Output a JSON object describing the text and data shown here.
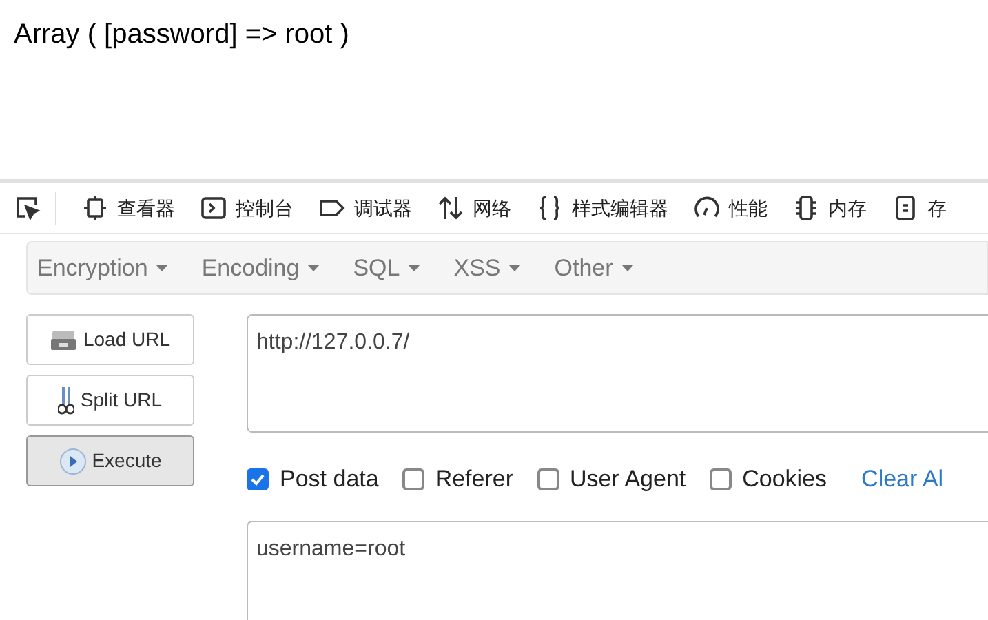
{
  "output_text": "Array ( [password] => root )",
  "devtools_tabs": [
    {
      "kind": "picker"
    },
    {
      "kind": "inspector",
      "label": "查看器"
    },
    {
      "kind": "console",
      "label": "控制台"
    },
    {
      "kind": "debugger",
      "label": "调试器"
    },
    {
      "kind": "network",
      "label": "网络"
    },
    {
      "kind": "style",
      "label": "样式编辑器"
    },
    {
      "kind": "performance",
      "label": "性能"
    },
    {
      "kind": "memory",
      "label": "内存"
    },
    {
      "kind": "storage",
      "label": "存"
    }
  ],
  "hackbar_menu": [
    "Encryption",
    "Encoding",
    "SQL",
    "XSS",
    "Other"
  ],
  "actions": [
    {
      "kind": "load",
      "label": "Load URL",
      "selected": false
    },
    {
      "kind": "split",
      "label": "Split URL",
      "selected": false
    },
    {
      "kind": "execute",
      "label": "Execute",
      "selected": true
    }
  ],
  "url": "http://127.0.0.7/",
  "options": [
    {
      "label": "Post data",
      "checked": true
    },
    {
      "label": "Referer",
      "checked": false
    },
    {
      "label": "User Agent",
      "checked": false
    },
    {
      "label": "Cookies",
      "checked": false
    }
  ],
  "clear_link": "Clear Al",
  "post_body": "username=root"
}
